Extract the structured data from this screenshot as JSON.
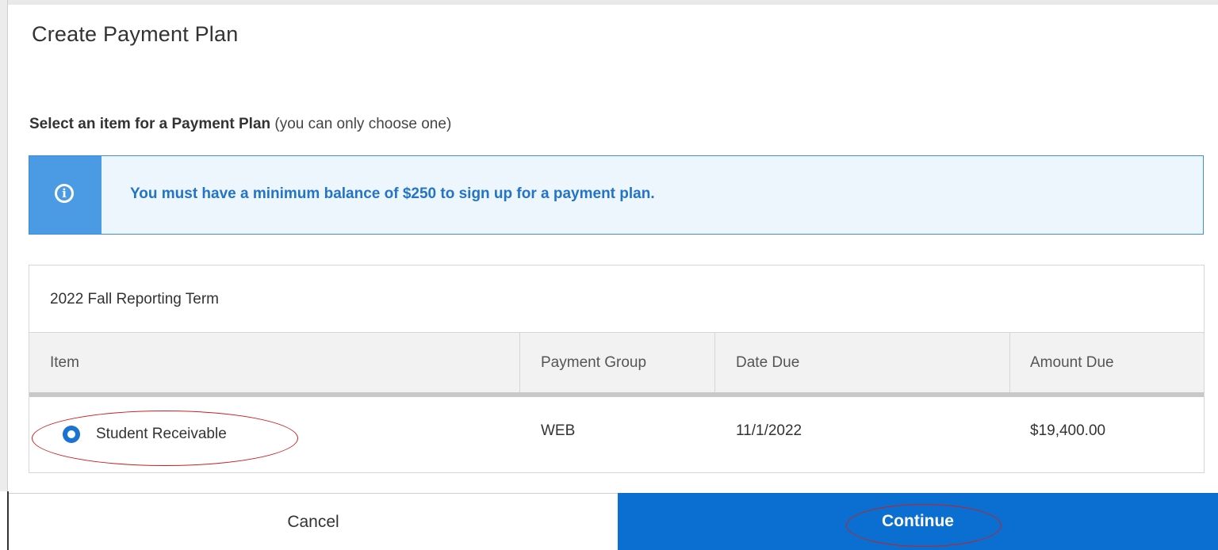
{
  "dialog": {
    "title": "Create Payment Plan",
    "instruction_bold": "Select an item for a Payment Plan",
    "instruction_note": "(you can only choose one)"
  },
  "alert": {
    "icon": "info-icon",
    "message": "You must have a minimum balance of $250 to sign up for a payment plan."
  },
  "table": {
    "term": "2022 Fall Reporting Term",
    "columns": [
      "Item",
      "Payment Group",
      "Date Due",
      "Amount Due"
    ],
    "rows": [
      {
        "selected": true,
        "item": "Student Receivable",
        "payment_group": "WEB",
        "date_due": "11/1/2022",
        "amount_due": "$19,400.00"
      }
    ]
  },
  "footer": {
    "cancel_label": "Cancel",
    "continue_label": "Continue"
  },
  "colors": {
    "accent": "#0a6fd1",
    "alert_text": "#2374c6",
    "alert_icon_bg": "#4a9be4",
    "annotation": "#cc1f1f"
  }
}
